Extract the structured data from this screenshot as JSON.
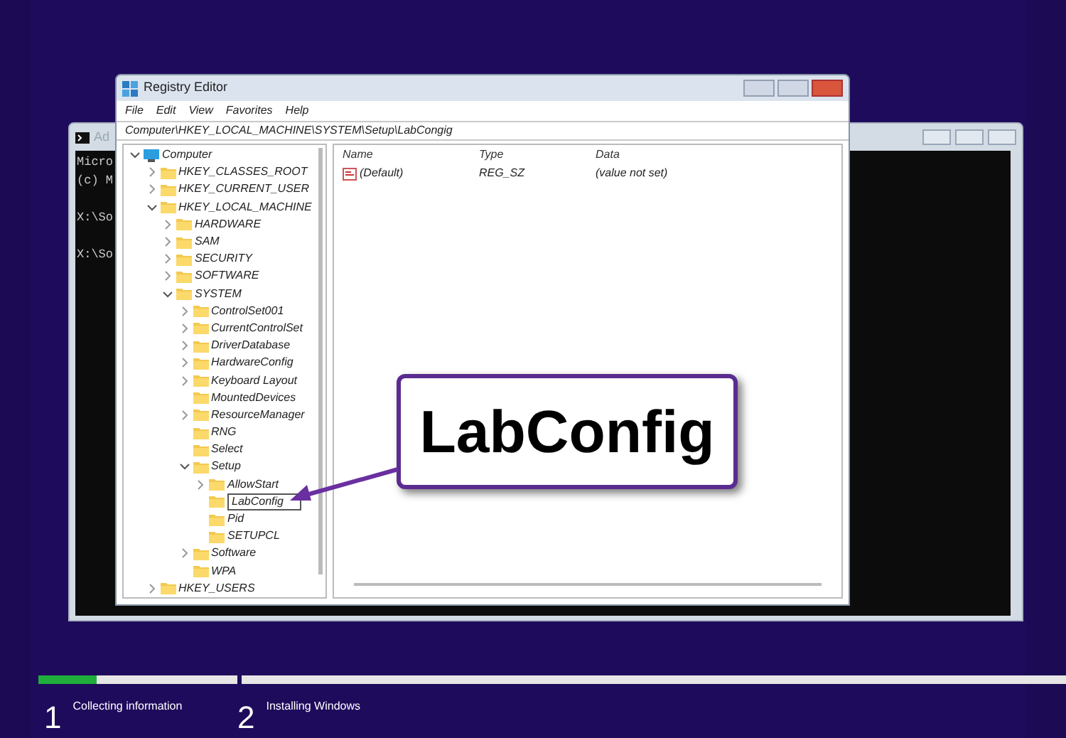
{
  "console": {
    "title": "Ad",
    "blocks": [
      [
        "Micro",
        "(c) M"
      ],
      [
        "X:\\So"
      ],
      [
        "X:\\So"
      ]
    ]
  },
  "registry": {
    "title": "Registry Editor",
    "menu": [
      "File",
      "Edit",
      "View",
      "Favorites",
      "Help"
    ],
    "address": "Computer\\HKEY_LOCAL_MACHINE\\SYSTEM\\Setup\\LabCongig",
    "tree": [
      {
        "label": "Computer",
        "kind": "computer",
        "expanded": true,
        "children": [
          {
            "label": "HKEY_CLASSES_ROOT",
            "kind": "folder",
            "expanded": false
          },
          {
            "label": "HKEY_CURRENT_USER",
            "kind": "folder",
            "expanded": false
          },
          {
            "label": "HKEY_LOCAL_MACHINE",
            "kind": "folder",
            "expanded": true,
            "children": [
              {
                "label": "HARDWARE",
                "kind": "folder",
                "expanded": false
              },
              {
                "label": "SAM",
                "kind": "folder",
                "expanded": false
              },
              {
                "label": "SECURITY",
                "kind": "folder",
                "expanded": false
              },
              {
                "label": "SOFTWARE",
                "kind": "folder",
                "expanded": false
              },
              {
                "label": "SYSTEM",
                "kind": "folder",
                "expanded": true,
                "children": [
                  {
                    "label": "ControlSet001",
                    "kind": "folder",
                    "expanded": false
                  },
                  {
                    "label": "CurrentControlSet",
                    "kind": "folder",
                    "expanded": false
                  },
                  {
                    "label": "DriverDatabase",
                    "kind": "folder",
                    "expanded": false
                  },
                  {
                    "label": "HardwareConfig",
                    "kind": "folder",
                    "expanded": false
                  },
                  {
                    "label": "Keyboard Layout",
                    "kind": "folder",
                    "expanded": false
                  },
                  {
                    "label": "MountedDevices",
                    "kind": "leaf"
                  },
                  {
                    "label": "ResourceManager",
                    "kind": "folder",
                    "expanded": false
                  },
                  {
                    "label": "RNG",
                    "kind": "leaf"
                  },
                  {
                    "label": "Select",
                    "kind": "leaf"
                  },
                  {
                    "label": "Setup",
                    "kind": "folder",
                    "expanded": true,
                    "children": [
                      {
                        "label": "AllowStart",
                        "kind": "folder",
                        "expanded": false
                      },
                      {
                        "label": "LabConfig",
                        "kind": "rename"
                      },
                      {
                        "label": "Pid",
                        "kind": "leaf"
                      },
                      {
                        "label": "SETUPCL",
                        "kind": "leaf"
                      }
                    ]
                  },
                  {
                    "label": "Software",
                    "kind": "folder",
                    "expanded": false
                  },
                  {
                    "label": "WPA",
                    "kind": "leaf"
                  }
                ]
              }
            ]
          },
          {
            "label": "HKEY_USERS",
            "kind": "folder",
            "expanded": false
          }
        ]
      }
    ],
    "columns": [
      "Name",
      "Type",
      "Data"
    ],
    "values": [
      {
        "name": "(Default)",
        "type": "REG_SZ",
        "data": "(value not set)"
      }
    ]
  },
  "callout": {
    "text": "LabConfig"
  },
  "setup": {
    "steps": [
      {
        "number": "1",
        "label": "Collecting information",
        "level": 0.29
      },
      {
        "number": "2",
        "label": "Installing Windows",
        "level": 0
      }
    ]
  }
}
